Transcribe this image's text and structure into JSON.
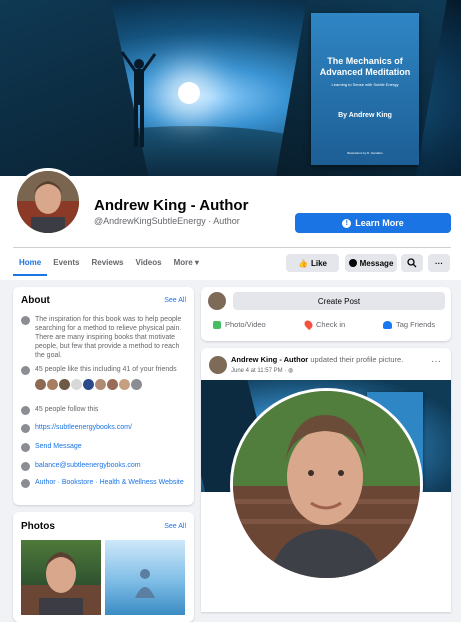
{
  "cover": {
    "book_title": "The Mechanics of Advanced Meditation",
    "book_subtitle": "Learning to Sense with Subtle Energy",
    "book_author": "By Andrew King",
    "book_illustrations": "Illustrations by D. Hamilton"
  },
  "profile": {
    "name": "Andrew King - Author",
    "handle": "@AndrewKingSubtleEnergy · Author",
    "learn_more": "Learn More"
  },
  "tabs": [
    {
      "label": "Home",
      "active": true
    },
    {
      "label": "Events"
    },
    {
      "label": "Reviews"
    },
    {
      "label": "Videos"
    },
    {
      "label": "More ▾"
    }
  ],
  "actions": {
    "like": "Like",
    "message": "Message"
  },
  "about": {
    "title": "About",
    "see_all": "See All",
    "description": "The inspiration for this book was to help people searching for a method to relieve physical pain. There are many inspiring books that motivate people, but few that provide a method to reach the goal.",
    "likes": "45 people like this including 41 of your friends",
    "follows": "45 people follow this",
    "website": "https://subtleenergybooks.com/",
    "send_message": "Send Message",
    "email": "balance@subtleenergybooks.com",
    "categories": "Author · Bookstore · Health & Wellness Website"
  },
  "photos": {
    "title": "Photos",
    "see_all": "See All"
  },
  "composer": {
    "create_post": "Create Post",
    "photo_video": "Photo/Video",
    "check_in": "Check in",
    "tag_friends": "Tag Friends"
  },
  "post": {
    "author": "Andrew King - Author",
    "action": "updated their profile picture.",
    "date": "June 4 at 11:57 PM ·"
  },
  "colors": {
    "accent": "#1b74e4",
    "page_bg": "#f0f2f5"
  }
}
